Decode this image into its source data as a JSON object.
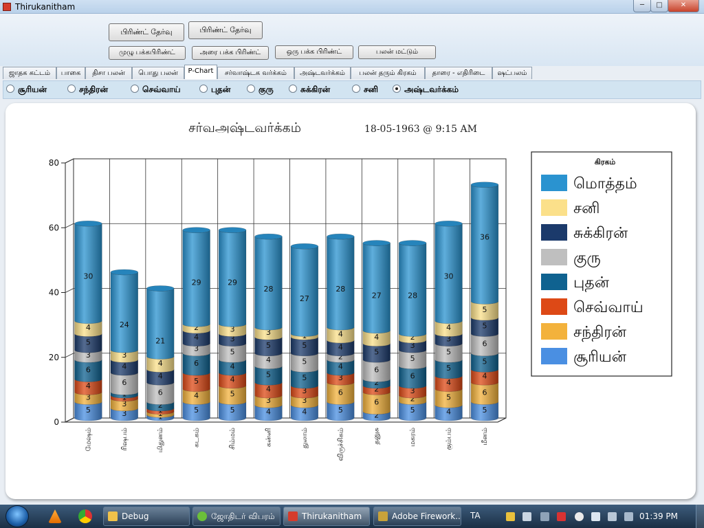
{
  "window": {
    "title": "Thirukanitham",
    "controls": {
      "minimize": "─",
      "maximize": "□",
      "close": "✕"
    }
  },
  "toolbar": {
    "print_select_1": "பிரிண்ட் தேர்வு",
    "print_select_2": "பிரிண்ட் தேர்வு",
    "full_page_print": "முழு பக்கபிரிண்ட்",
    "half_page_print": "அரை பக்க பிரிண்ட்",
    "one_page_print": "ஒரு பக்க பிரிண்ட்",
    "results_only": "பலன் மட்டும்"
  },
  "tabs": [
    {
      "label": "ஜாதக கட்டம்"
    },
    {
      "label": "பாகை"
    },
    {
      "label": "திசா பலன்"
    },
    {
      "label": "பொது பலன்"
    },
    {
      "label": "P-Chart",
      "active": true
    },
    {
      "label": "சர்வாஷ்டக வர்க்கம்"
    },
    {
      "label": "அஷ்டவர்க்கம்"
    },
    {
      "label": "பலன் தரும் கிரகம்"
    },
    {
      "label": "தாரை - எதிரிடை"
    },
    {
      "label": "ஷட்பலம்"
    }
  ],
  "radios": [
    {
      "label": "சூரியன்",
      "checked": false
    },
    {
      "label": "சந்திரன்",
      "checked": false
    },
    {
      "label": "செவ்வாய்",
      "checked": false
    },
    {
      "label": "புதன்",
      "checked": false
    },
    {
      "label": "குரு",
      "checked": false
    },
    {
      "label": "சுக்கிரன்",
      "checked": false
    },
    {
      "label": "சனி",
      "checked": false
    },
    {
      "label": "அஷ்டவர்க்கம்",
      "checked": true
    }
  ],
  "chart_data": {
    "type": "bar",
    "stacked": true,
    "style": "3d-cylinder",
    "title": "சர்வஅஷ்டவர்க்கம்",
    "subtitle": "18-05-1963 @ 9:15 AM",
    "xlabel": "",
    "ylabel": "",
    "ylim": [
      0,
      80
    ],
    "yticks": [
      0,
      20,
      40,
      60,
      80
    ],
    "grid": true,
    "legend_title": "கிரகம்",
    "legend_position": "right",
    "categories": [
      "மேஷம்",
      "ரிஷபம்",
      "மிதுனம்",
      "கடகம்",
      "சிம்மம்",
      "கன்னி",
      "துலாம்",
      "விருச்சிகம்",
      "தனுசு",
      "மகரம்",
      "கும்பம்",
      "மீனம்"
    ],
    "series": [
      {
        "name": "சூரியன்",
        "color": "#4a8fe2",
        "values": [
          5,
          3,
          1,
          5,
          5,
          4,
          4,
          5,
          2,
          5,
          4,
          5
        ]
      },
      {
        "name": "சந்திரன்",
        "color": "#f3b23c",
        "values": [
          3,
          3,
          1,
          4,
          5,
          3,
          3,
          6,
          6,
          2,
          5,
          6
        ]
      },
      {
        "name": "செவ்வாய்",
        "color": "#dd4916",
        "values": [
          4,
          1,
          1,
          5,
          4,
          4,
          3,
          3,
          2,
          3,
          4,
          4
        ]
      },
      {
        "name": "புதன்",
        "color": "#0f6290",
        "values": [
          6,
          1,
          2,
          6,
          4,
          5,
          5,
          4,
          2,
          6,
          5,
          5
        ]
      },
      {
        "name": "குரு",
        "color": "#bfbfbf",
        "values": [
          3,
          6,
          6,
          3,
          5,
          4,
          5,
          2,
          6,
          5,
          5,
          6
        ]
      },
      {
        "name": "சுக்கிரன்",
        "color": "#1b3a6b",
        "values": [
          5,
          4,
          4,
          4,
          3,
          5,
          5,
          4,
          5,
          3,
          3,
          5
        ]
      },
      {
        "name": "சனி",
        "color": "#fbe08a",
        "values": [
          4,
          3,
          4,
          2,
          3,
          3,
          1,
          4,
          4,
          2,
          4,
          5
        ]
      },
      {
        "name": "மொத்தம்",
        "color": "#2a93d0",
        "values": [
          30,
          24,
          21,
          29,
          29,
          28,
          27,
          28,
          27,
          28,
          30,
          36
        ]
      }
    ]
  },
  "taskbar": {
    "items": [
      {
        "label": "Debug"
      },
      {
        "label": "ஜோதிடர் விபரம்"
      },
      {
        "label": "Thirukanitham"
      },
      {
        "label": "Adobe Firework..."
      }
    ],
    "language": "TA",
    "clock": "01:39 PM"
  }
}
